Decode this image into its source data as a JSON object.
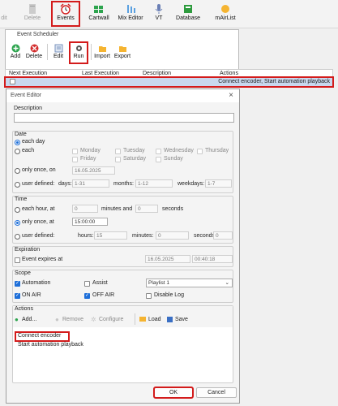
{
  "main_toolbar": {
    "partial_left": "dit",
    "delete": "Delete",
    "events": "Events",
    "cartwall": "Cartwall",
    "mix_editor": "Mix Editor",
    "vt": "VT",
    "database": "Database",
    "mairlist": "mAirList"
  },
  "scheduler": {
    "title": "Event Scheduler",
    "toolbar": {
      "add": "Add",
      "delete": "Delete",
      "edit": "Edit",
      "run": "Run",
      "import": "Import",
      "export": "Export"
    },
    "columns": [
      "Next Execution",
      "Last Execution",
      "Description",
      "Actions"
    ],
    "row": {
      "actions": "Connect encoder, Start automation playback"
    }
  },
  "editor": {
    "title": "Event Editor",
    "close": "×",
    "description": {
      "label": "Description",
      "value": ""
    },
    "date": {
      "label": "Date",
      "each_day": "each day",
      "each": "each",
      "days": [
        "Monday",
        "Tuesday",
        "Wednesday",
        "Thursday",
        "Friday",
        "Saturday",
        "Sunday"
      ],
      "only_once_on": "only once, on",
      "only_once_value": "16.05.2025",
      "user_defined": "user defined:",
      "days_label": "days:",
      "days_value": "1-31",
      "months_label": "months:",
      "months_value": "1-12",
      "weekdays_label": "weekdays:",
      "weekdays_value": "1-7"
    },
    "time": {
      "label": "Time",
      "each_hour_at": "each hour, at",
      "each_hour_minutes": "0",
      "minutes_and": "minutes and",
      "each_hour_seconds": "0",
      "seconds": "seconds",
      "only_once_at": "only once, at",
      "only_once_time": "15:00:00",
      "user_defined": "user defined:",
      "hours_label": "hours:",
      "hours_value": "15",
      "minutes_label": "minutes:",
      "minutes_value": "0",
      "seconds_label": "seconds:",
      "seconds_value": "0"
    },
    "expiration": {
      "label": "Expiration",
      "checkbox": "Event expires at",
      "date": "16.05.2025",
      "time": "00:40:18"
    },
    "scope": {
      "label": "Scope",
      "automation": "Automation",
      "assist": "Assist",
      "playlist": "Playlist 1",
      "on_air": "ON AIR",
      "off_air": "OFF AIR",
      "disable_log": "Disable Log"
    },
    "actions": {
      "label": "Actions",
      "add": "Add...",
      "remove": "Remove",
      "configure": "Configure",
      "load": "Load",
      "save": "Save",
      "items": [
        "Connect encoder",
        "Start automation playback"
      ]
    },
    "ok": "OK",
    "cancel": "Cancel"
  },
  "colors": {
    "accent": "#1e6fd9",
    "highlight": "#d31b1b",
    "selection": "#c9d8ee"
  }
}
